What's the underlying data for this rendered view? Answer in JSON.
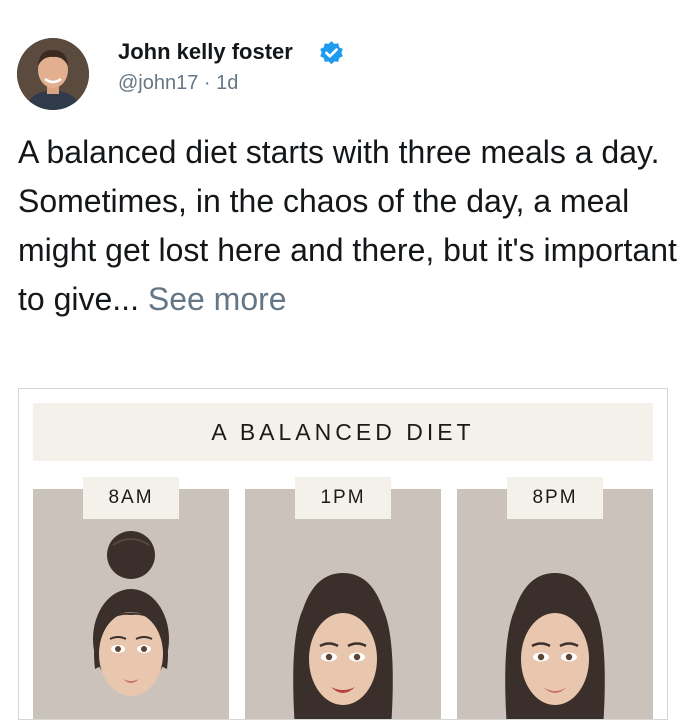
{
  "author": {
    "name": "John kelly foster",
    "handle": "@john17 · 1d",
    "verified": true
  },
  "tweet": {
    "text": "A balanced diet starts with three meals a day. Sometimes, in the chaos of the day, a meal might get lost here and there, but it's important to give... ",
    "see_more": "See more"
  },
  "media": {
    "title": "A BALANCED DIET",
    "panels": [
      {
        "time": "8AM"
      },
      {
        "time": "1PM"
      },
      {
        "time": "8PM"
      }
    ]
  },
  "colors": {
    "verified_badge": "#1d9bf0",
    "secondary_text": "#657786",
    "panel_bg": "#cbc3bb",
    "label_bg": "#f3f1ea"
  }
}
